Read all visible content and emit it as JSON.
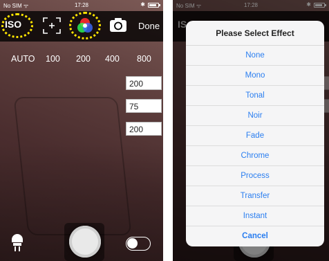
{
  "left": {
    "status": {
      "carrier": "No SIM ᯤ",
      "time": "17:28",
      "bluetooth": "✱"
    },
    "toolbar": {
      "iso_label": "ISO",
      "done_label": "Done",
      "icons": [
        "focus-icon",
        "color-effect-icon",
        "camera-flip-icon"
      ],
      "highlight_color": "#ffe500"
    },
    "iso_options": [
      "AUTO",
      "100",
      "200",
      "400",
      "800"
    ],
    "values": [
      "200",
      "75",
      "200"
    ],
    "bottom": {
      "icons": [
        "torch-icon",
        "shutter-button",
        "toggle-switch"
      ]
    }
  },
  "right": {
    "status": {
      "carrier": "No SIM ᯤ",
      "time": "17:28",
      "bluetooth": "✱"
    },
    "toolbar_partial_label": "IS",
    "dialog": {
      "title": "Please Select Effect",
      "options": [
        "None",
        "Mono",
        "Tonal",
        "Noir",
        "Fade",
        "Chrome",
        "Process",
        "Transfer",
        "Instant"
      ],
      "cancel_label": "Cancel",
      "accent": "#2a7ef0"
    }
  }
}
